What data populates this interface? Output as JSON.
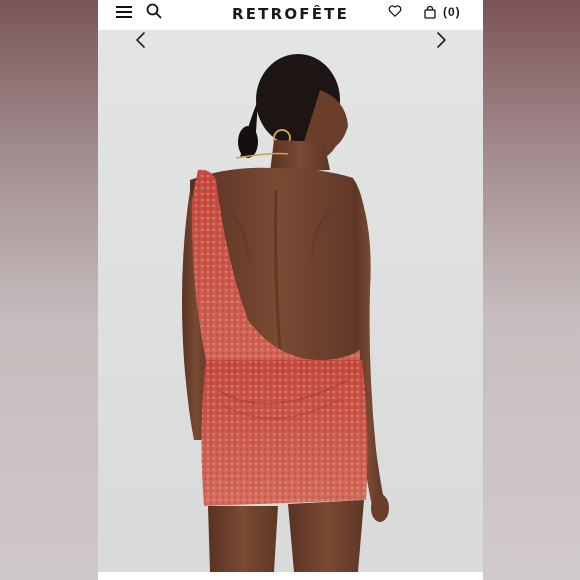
{
  "header": {
    "brand": "RETROFÊTE",
    "menu_icon": "hamburger-menu-icon",
    "search_icon": "search-icon",
    "wishlist_icon": "heart-icon",
    "bag_icon": "shopping-bag-icon",
    "bag_count": "(0)"
  },
  "gallery": {
    "prev_icon": "chevron-left-icon",
    "next_icon": "chevron-right-icon",
    "image_subject": "product-photo"
  },
  "colors": {
    "background": "#ffffff",
    "photo_backdrop": "#dfe0e0",
    "dress": "#c9524a",
    "skin": "#6b3e2c",
    "text": "#1a1a1a"
  }
}
